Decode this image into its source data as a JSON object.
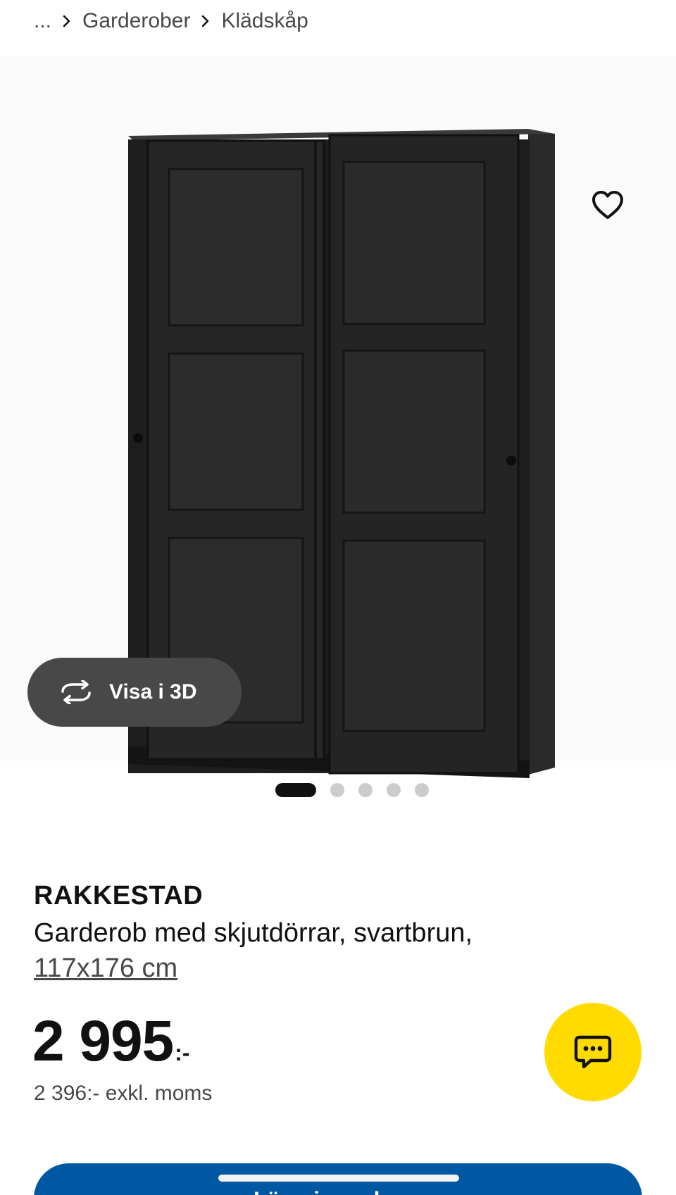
{
  "breadcrumb": {
    "ellipsis": "...",
    "items": [
      "Garderober",
      "Klädskåp"
    ]
  },
  "gallery": {
    "view_3d_label": "Visa i 3D",
    "image_count": 5,
    "active_index": 0,
    "favorite_icon": "heart-outline-icon",
    "rotate_icon": "rotate-3d-icon"
  },
  "product": {
    "name": "RAKKESTAD",
    "description": "Garderob med skjutdörrar, svartbrun,",
    "size": "117x176 cm",
    "price_int": "2 995",
    "price_suffix": ":-",
    "price_excl": "2 396:- exkl. moms"
  },
  "actions": {
    "add_to_cart_label": "Lägg i varukorg",
    "chat_icon": "chat-icon"
  },
  "colors": {
    "accent_blue": "#0058a3",
    "chat_yellow": "#ffdb00",
    "pill_gray": "#484848",
    "text_dark": "#111111"
  }
}
